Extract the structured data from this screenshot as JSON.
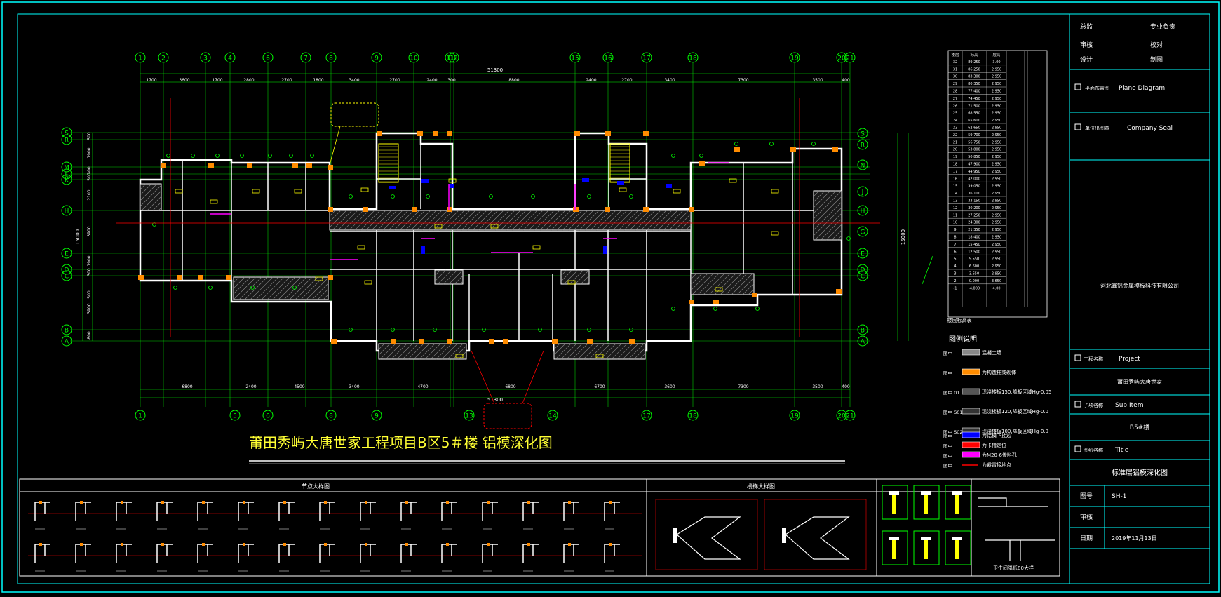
{
  "drawing_title": "莆田秀屿大唐世家工程项目B区5＃楼 铝模深化图",
  "overall_dim": "51300",
  "top_axes": [
    "1",
    "2",
    "3",
    "4",
    "6",
    "7",
    "8",
    "9",
    "10",
    "11",
    "12",
    "15",
    "16",
    "17",
    "18",
    "19",
    "20",
    "21"
  ],
  "bottom_axes": [
    "1",
    "5",
    "6",
    "8",
    "9",
    "13",
    "14",
    "17",
    "18",
    "19",
    "20",
    "21"
  ],
  "left_axes": [
    "S",
    "R",
    "M",
    "L",
    "K",
    "H",
    "E",
    "D",
    "C",
    "B",
    "A"
  ],
  "right_axes": [
    "S",
    "R",
    "N",
    "J",
    "H",
    "G",
    "E",
    "D",
    "C",
    "B",
    "A"
  ],
  "top_dims": [
    "1700",
    "3600",
    "1700",
    "2800",
    "2700",
    "1800",
    "3400",
    "2700",
    "2400",
    "300",
    "8800",
    "2400",
    "2700",
    "3400",
    "7300",
    "3500",
    "400"
  ],
  "bottom_dims": [
    "6800",
    "2400",
    "4500",
    "3400",
    "4700",
    "6800",
    "6700",
    "3600",
    "7300",
    "3500",
    "400"
  ],
  "left_dims": [
    "500",
    "1900",
    "300",
    "500",
    "2100",
    "3900",
    "1900",
    "300",
    "500",
    "3900",
    "800"
  ],
  "left_total": "15000",
  "right_total": "15000",
  "sections": {
    "node_details": "节点大样图",
    "stair_details": "楼梯大样图",
    "slab_section": "卫生间降低80大样"
  },
  "legend": {
    "title": "图例说明",
    "items": [
      {
        "code": "图中",
        "text": "混凝土墙"
      },
      {
        "code": "图中",
        "text": "为构造柱或砌体"
      },
      {
        "code": "图中 01",
        "text": "现浇楼板150,降板区域Hg-0.05"
      },
      {
        "code": "图中 S01",
        "text": "现浇楼板120,降板区域Hg-0.0"
      },
      {
        "code": "图中 S02",
        "text": "现浇楼板100,降板区域Hg-0.0"
      },
      {
        "code": "图中",
        "text": "为铝模下挂边"
      },
      {
        "code": "图中",
        "text": "为卡槽定位"
      },
      {
        "code": "图中",
        "text": "为M20-6传料孔"
      },
      {
        "code": "图中",
        "text": "为避雷接地点"
      }
    ]
  },
  "title_block": {
    "row1": [
      "总监",
      "专业负责"
    ],
    "row2": [
      "审核",
      "校对"
    ],
    "row3": [
      "设计",
      "制图"
    ],
    "plane_label": "平面布置图",
    "plane_en": "Plane Diagram",
    "seal_label": "单位出图章",
    "seal_en": "Company Seal",
    "company": "河北鑫铝金属模板科技有限公司",
    "project_label": "工程名称",
    "project_en": "Project",
    "project_name": "莆田秀屿大唐世家",
    "sub_label": "子项名称",
    "sub_en": "Sub Item",
    "sub_name": "B5#楼",
    "title_label": "图纸名称",
    "title_en": "Title",
    "title_name": "标准层铝模深化图",
    "drawing_no_label": "图号",
    "drawing_no": "SH-1",
    "approve_label": "审核",
    "date_label": "日期",
    "date": "2019年11月13日"
  },
  "table": {
    "header": [
      "楼层",
      "标高",
      "层高"
    ],
    "rows": [
      [
        "32",
        "89.250",
        "3.00"
      ],
      [
        "31",
        "86.250",
        "2.950"
      ],
      [
        "30",
        "83.300",
        "2.950"
      ],
      [
        "29",
        "80.350",
        "2.950"
      ],
      [
        "28",
        "77.400",
        "2.950"
      ],
      [
        "27",
        "74.450",
        "2.950"
      ],
      [
        "26",
        "71.500",
        "2.950"
      ],
      [
        "25",
        "68.550",
        "2.950"
      ],
      [
        "24",
        "65.600",
        "2.950"
      ],
      [
        "23",
        "62.650",
        "2.950"
      ],
      [
        "22",
        "59.700",
        "2.950"
      ],
      [
        "21",
        "56.750",
        "2.950"
      ],
      [
        "20",
        "53.800",
        "2.950"
      ],
      [
        "19",
        "50.850",
        "2.950"
      ],
      [
        "18",
        "47.900",
        "2.950"
      ],
      [
        "17",
        "44.950",
        "2.950"
      ],
      [
        "16",
        "42.000",
        "2.950"
      ],
      [
        "15",
        "39.050",
        "2.950"
      ],
      [
        "14",
        "36.100",
        "2.950"
      ],
      [
        "13",
        "33.150",
        "2.950"
      ],
      [
        "12",
        "30.200",
        "2.950"
      ],
      [
        "11",
        "27.250",
        "2.950"
      ],
      [
        "10",
        "24.300",
        "2.950"
      ],
      [
        "9",
        "21.350",
        "2.950"
      ],
      [
        "8",
        "18.400",
        "2.950"
      ],
      [
        "7",
        "15.450",
        "2.950"
      ],
      [
        "6",
        "12.500",
        "2.950"
      ],
      [
        "5",
        "9.550",
        "2.950"
      ],
      [
        "4",
        "6.600",
        "2.950"
      ],
      [
        "3",
        "3.650",
        "2.950"
      ],
      [
        "2",
        "0.000",
        "3.650"
      ],
      [
        "-1",
        "-4.000",
        "4.00"
      ]
    ],
    "footer": "楼层标高表"
  },
  "colors": {
    "grid": "#00ff00",
    "frame": "#00ffff",
    "wall": "#ffffff",
    "orange": "#ff8c00",
    "yellow": "#ffff00",
    "red": "#ff0000",
    "magenta": "#ff00ff",
    "blue": "#0000ff",
    "bg": "#000000"
  }
}
